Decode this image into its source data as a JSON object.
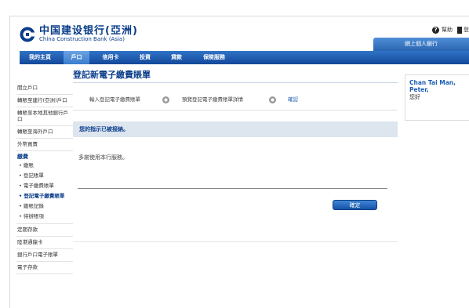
{
  "header": {
    "logo_cn": "中国建设银行(亞洲)",
    "logo_en": "China Construction Bank (Asia)",
    "help_label": "幫助",
    "logout_label": "登出",
    "login_tab": "網上個人銀行"
  },
  "nav": {
    "items": [
      {
        "label": "我的主頁"
      },
      {
        "label": "戶口"
      },
      {
        "label": "信用卡"
      },
      {
        "label": "投資"
      },
      {
        "label": "貸款"
      },
      {
        "label": "保險服務"
      }
    ],
    "active_index": 1
  },
  "sidebar": {
    "top_items": [
      {
        "label": "開立戶口"
      },
      {
        "label": "轉賬至建行(亞洲)戶口"
      },
      {
        "label": "轉賬至本地其他銀行戶口"
      },
      {
        "label": "轉賬至海外戶口"
      },
      {
        "label": "外幣買賣"
      }
    ],
    "group_title": "繳費",
    "group_items": [
      {
        "label": "• 繳賬"
      },
      {
        "label": "• 登記賬單"
      },
      {
        "label": "• 電子繳費賬單"
      },
      {
        "label": "• 登記電子繳費賬單"
      },
      {
        "label": "• 繳賬記錄"
      },
      {
        "label": "• 待辦賬項"
      }
    ],
    "bottom_items": [
      {
        "label": "定期存款"
      },
      {
        "label": "陸港通龍卡"
      },
      {
        "label": "銀行戶口電子賬單"
      },
      {
        "label": "電子存款"
      }
    ]
  },
  "main": {
    "title": "登記新電子繳費賬單",
    "steps": [
      {
        "label": "輸入登記電子繳費賬單"
      },
      {
        "label": "預覽登記電子繳費賬單詳情"
      },
      {
        "label": "確認"
      }
    ],
    "notice": "您的指示已被接納。",
    "thanks": "多謝使用本行服務。",
    "confirm_button": "確定"
  },
  "user": {
    "name": "Chan Tai Man, Peter,",
    "greeting": "您好"
  },
  "colors": {
    "brand_blue": "#0a3d8a",
    "nav_blue": "#14489a",
    "link_blue": "#1a5db3",
    "notice_bg": "#dde5ef"
  }
}
